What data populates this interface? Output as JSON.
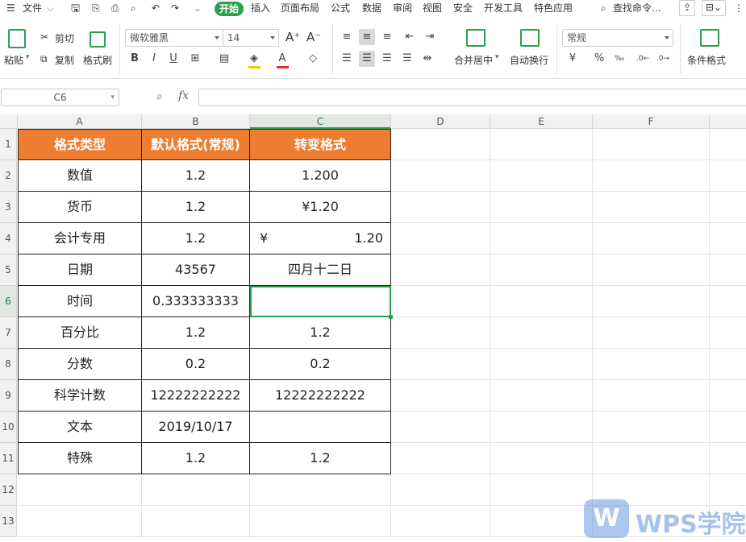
{
  "menubar": {
    "file": "文件",
    "tabs": [
      "开始",
      "插入",
      "页面布局",
      "公式",
      "数据",
      "审阅",
      "视图",
      "安全",
      "开发工具",
      "特色应用"
    ],
    "active_tab": "开始",
    "search": "查找命令..."
  },
  "ribbon": {
    "paste": "粘贴",
    "cut": "剪切",
    "copy": "复制",
    "format_painter": "格式刷",
    "font_name": "微软雅黑",
    "font_size": "14",
    "bold": "B",
    "italic": "I",
    "underline": "U",
    "merge_center": "合并居中",
    "wrap_text": "自动换行",
    "number_format": "常规",
    "percent": "%",
    "currency": "¥",
    "conditional_format": "条件格式",
    "accent": "#2d9f4e",
    "font_color": "#e03030",
    "fill_color": "#f5c400"
  },
  "formulabar": {
    "name_box": "C6",
    "fx": "fx",
    "value": ""
  },
  "sheet": {
    "columns": [
      "A",
      "B",
      "C",
      "D",
      "E",
      "F"
    ],
    "selected_column": "C",
    "rows": [
      "1",
      "2",
      "3",
      "4",
      "5",
      "6",
      "7",
      "8",
      "9",
      "10",
      "11",
      "12",
      "13"
    ],
    "selected_row": "6",
    "header": [
      "格式类型",
      "默认格式(常规)",
      "转变格式"
    ],
    "header_color": "#ed7d31",
    "data": [
      [
        "数值",
        "1.2",
        "1.200"
      ],
      [
        "货币",
        "1.2",
        "¥1.20"
      ],
      [
        "会计专用",
        "1.2",
        "1.20"
      ],
      [
        "日期",
        "43567",
        "四月十二日"
      ],
      [
        "时间",
        "0.333333333",
        ""
      ],
      [
        "百分比",
        "1.2",
        "1.2"
      ],
      [
        "分数",
        "0.2",
        "0.2"
      ],
      [
        "科学计数",
        "12222222222",
        "12222222222"
      ],
      [
        "文本",
        "2019/10/17",
        ""
      ],
      [
        "特殊",
        "1.2",
        "1.2"
      ]
    ],
    "accounting_symbol": "¥"
  },
  "watermark": {
    "text": "WPS学院",
    "color": "#4a7fd4"
  }
}
